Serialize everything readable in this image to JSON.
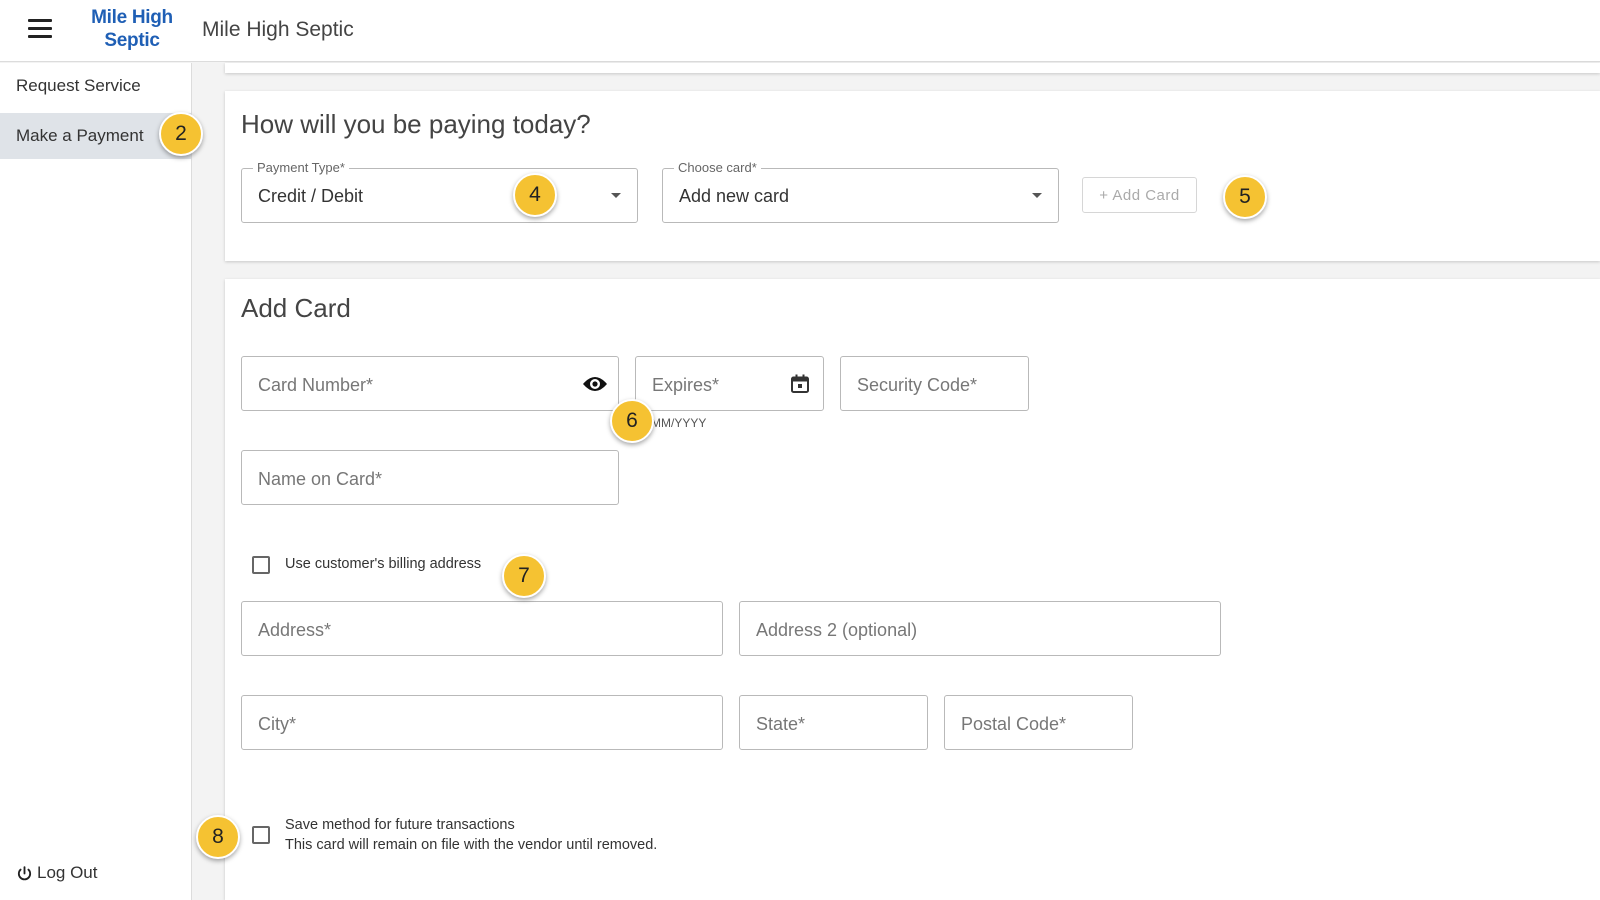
{
  "header": {
    "logo_line1": "Mile High",
    "logo_line2": "Septic",
    "title": "Mile High Septic"
  },
  "sidebar": {
    "items": [
      {
        "label": "Request Service"
      },
      {
        "label": "Make a Payment"
      }
    ],
    "logout_label": "Log Out"
  },
  "payment_section": {
    "title": "How will you be paying today?",
    "payment_type": {
      "label": "Payment Type*",
      "value": "Credit / Debit"
    },
    "choose_card": {
      "label": "Choose card*",
      "value": "Add new card"
    },
    "add_card_button": "+ Add Card"
  },
  "add_card_section": {
    "title": "Add Card",
    "card_number": {
      "placeholder": "Card Number*"
    },
    "expires": {
      "placeholder": "Expires*",
      "hint": "MM/YYYY"
    },
    "security_code": {
      "placeholder": "Security Code*"
    },
    "name_on_card": {
      "placeholder": "Name on Card*"
    },
    "use_billing_label": "Use customer's billing address",
    "address": {
      "placeholder": "Address*"
    },
    "address2": {
      "placeholder": "Address 2 (optional)"
    },
    "city": {
      "placeholder": "City*"
    },
    "state": {
      "placeholder": "State*"
    },
    "postal": {
      "placeholder": "Postal Code*"
    },
    "save_method_label": "Save method for future transactions",
    "save_method_sub": "This card will remain on file with the vendor until removed."
  },
  "callouts": [
    "2",
    "4",
    "5",
    "6",
    "7",
    "8"
  ],
  "colors": {
    "brand": "#1f5fb5",
    "callout": "#f5c232",
    "active_nav": "#dfe3e8"
  },
  "icons": [
    "hamburger-icon",
    "power-icon",
    "eye-icon",
    "calendar-icon",
    "dropdown-caret-icon"
  ]
}
